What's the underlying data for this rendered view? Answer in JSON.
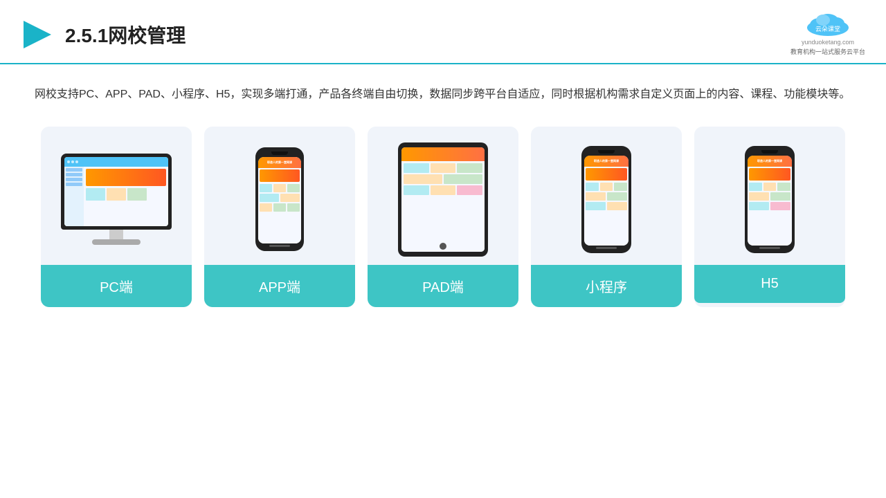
{
  "header": {
    "title": "2.5.1网校管理",
    "logo_name": "云朵课堂",
    "logo_url": "yunduoketang.com",
    "logo_slogan": "教育机构一站式服务云平台"
  },
  "description": {
    "text": "网校支持PC、APP、PAD、小程序、H5，实现多端打通，产品各终端自由切换，数据同步跨平台自适应，同时根据机构需求自定义页面上的内容、课程、功能模块等。"
  },
  "cards": [
    {
      "id": "pc",
      "label": "PC端"
    },
    {
      "id": "app",
      "label": "APP端"
    },
    {
      "id": "pad",
      "label": "PAD端"
    },
    {
      "id": "miniprogram",
      "label": "小程序"
    },
    {
      "id": "h5",
      "label": "H5"
    }
  ],
  "colors": {
    "accent": "#3ec5c5",
    "header_line": "#1ab3c8",
    "title": "#222222",
    "card_bg": "#f0f4fa"
  }
}
